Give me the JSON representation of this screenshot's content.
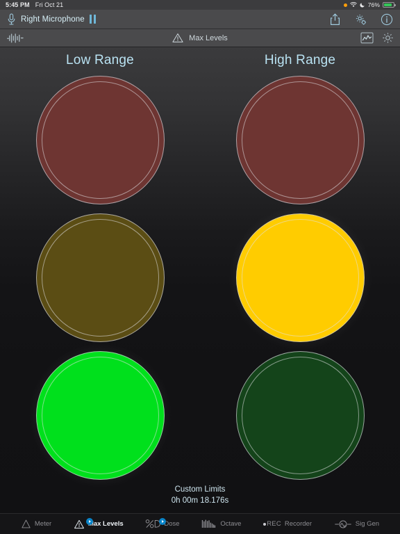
{
  "statusbar": {
    "time": "5:45 PM",
    "date": "Fri Oct 21",
    "battery_percent": "76%",
    "icons": [
      "orange-dot-icon",
      "wifi-icon",
      "moon-icon",
      "battery-charging-icon"
    ]
  },
  "navbar": {
    "mic_icon": "microphone-icon",
    "title": "Right Microphone",
    "pause_icon": "pause-icon",
    "share_icon": "share-icon",
    "settings_icon": "gear-icon",
    "info_icon": "info-icon"
  },
  "subbar": {
    "waveform_icon": "waveform-icon",
    "warning_icon": "warning-triangle-icon",
    "title": "Max Levels",
    "chart_icon": "chart-box-icon",
    "gear_icon": "gear-icon"
  },
  "main": {
    "columns": [
      {
        "label": "Low Range"
      },
      {
        "label": "High Range"
      }
    ],
    "lamps": [
      {
        "row": "red",
        "column": "Low Range",
        "state": "off",
        "color": "#6e3532"
      },
      {
        "row": "red",
        "column": "High Range",
        "state": "off",
        "color": "#6e3532"
      },
      {
        "row": "yellow",
        "column": "Low Range",
        "state": "off",
        "color": "#5b4d14"
      },
      {
        "row": "yellow",
        "column": "High Range",
        "state": "on",
        "color": "#ffcc00"
      },
      {
        "row": "green",
        "column": "Low Range",
        "state": "on",
        "color": "#00e01c"
      },
      {
        "row": "green",
        "column": "High Range",
        "state": "off",
        "color": "#14441a"
      }
    ],
    "footer_title": "Custom Limits",
    "footer_elapsed": "0h 00m 18.176s"
  },
  "tabbar": {
    "tabs": [
      {
        "label": "Meter",
        "icon": "meter-triangle-icon",
        "active": false,
        "badge": false
      },
      {
        "label": "Max Levels",
        "icon": "warning-triangle-icon",
        "active": true,
        "badge": true
      },
      {
        "label": "Dose",
        "icon": "percent-d-icon",
        "active": false,
        "badge": true
      },
      {
        "label": "Octave",
        "icon": "octave-bars-icon",
        "active": false,
        "badge": false
      },
      {
        "label": "Recorder",
        "icon": "rec-icon",
        "active": false,
        "badge": false,
        "prefix": "REC"
      },
      {
        "label": "Sig Gen",
        "icon": "sine-generator-icon",
        "active": false,
        "badge": false
      }
    ]
  },
  "colors": {
    "accent_blue": "#6fb7d8",
    "title_blue": "#b9e2f2",
    "nav_bg": "#4a4a4c",
    "tabbar_bg": "#151517",
    "lamp_red_off": "#6e3532",
    "lamp_yellow_off": "#5b4d14",
    "lamp_yellow_on": "#ffcc00",
    "lamp_green_on": "#00e01c",
    "lamp_green_off": "#14441a"
  }
}
